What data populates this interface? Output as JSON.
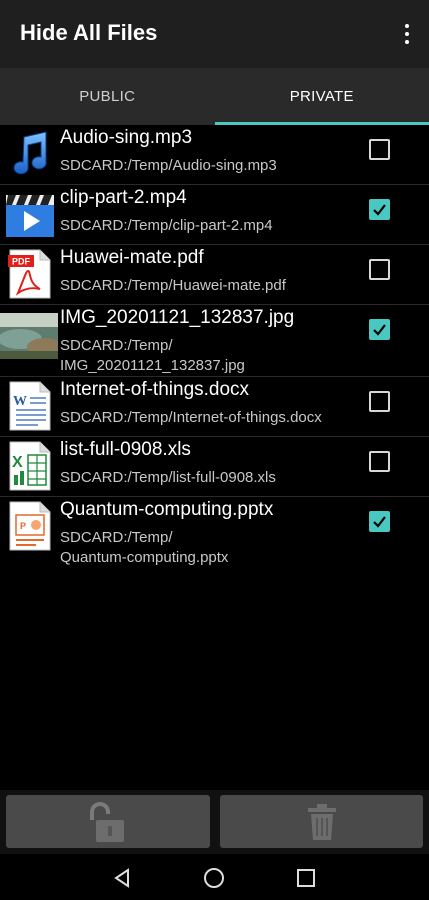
{
  "app": {
    "title": "Hide All Files"
  },
  "tabs": [
    {
      "label": "PUBLIC",
      "active": false
    },
    {
      "label": "PRIVATE",
      "active": true
    }
  ],
  "files": [
    {
      "name": "Audio-sing.mp3",
      "path": "SDCARD:/Temp/Audio-sing.mp3",
      "icon": "music-note-icon",
      "checked": false
    },
    {
      "name": "clip-part-2.mp4",
      "path": "SDCARD:/Temp/clip-part-2.mp4",
      "icon": "video-clapper-icon",
      "checked": true
    },
    {
      "name": "Huawei-mate.pdf",
      "path": "SDCARD:/Temp/Huawei-mate.pdf",
      "icon": "pdf-file-icon",
      "checked": false
    },
    {
      "name": "IMG_20201121_132837.jpg",
      "path": "SDCARD:/Temp/\nIMG_20201121_132837.jpg",
      "icon": "image-thumbnail",
      "checked": true
    },
    {
      "name": "Internet-of-things.docx",
      "path": "SDCARD:/Temp/Internet-of-things.docx",
      "icon": "word-file-icon",
      "checked": false
    },
    {
      "name": "list-full-0908.xls",
      "path": "SDCARD:/Temp/list-full-0908.xls",
      "icon": "excel-file-icon",
      "checked": false
    },
    {
      "name": "Quantum-computing.pptx",
      "path": "SDCARD:/Temp/\nQuantum-computing.pptx",
      "icon": "powerpoint-file-icon",
      "checked": true
    }
  ],
  "actions": {
    "unlock_icon": "unlock-icon",
    "delete_icon": "trash-icon"
  },
  "colors": {
    "accent": "#49c7c1",
    "background": "#000000",
    "appbar": "#1f1f1f"
  }
}
